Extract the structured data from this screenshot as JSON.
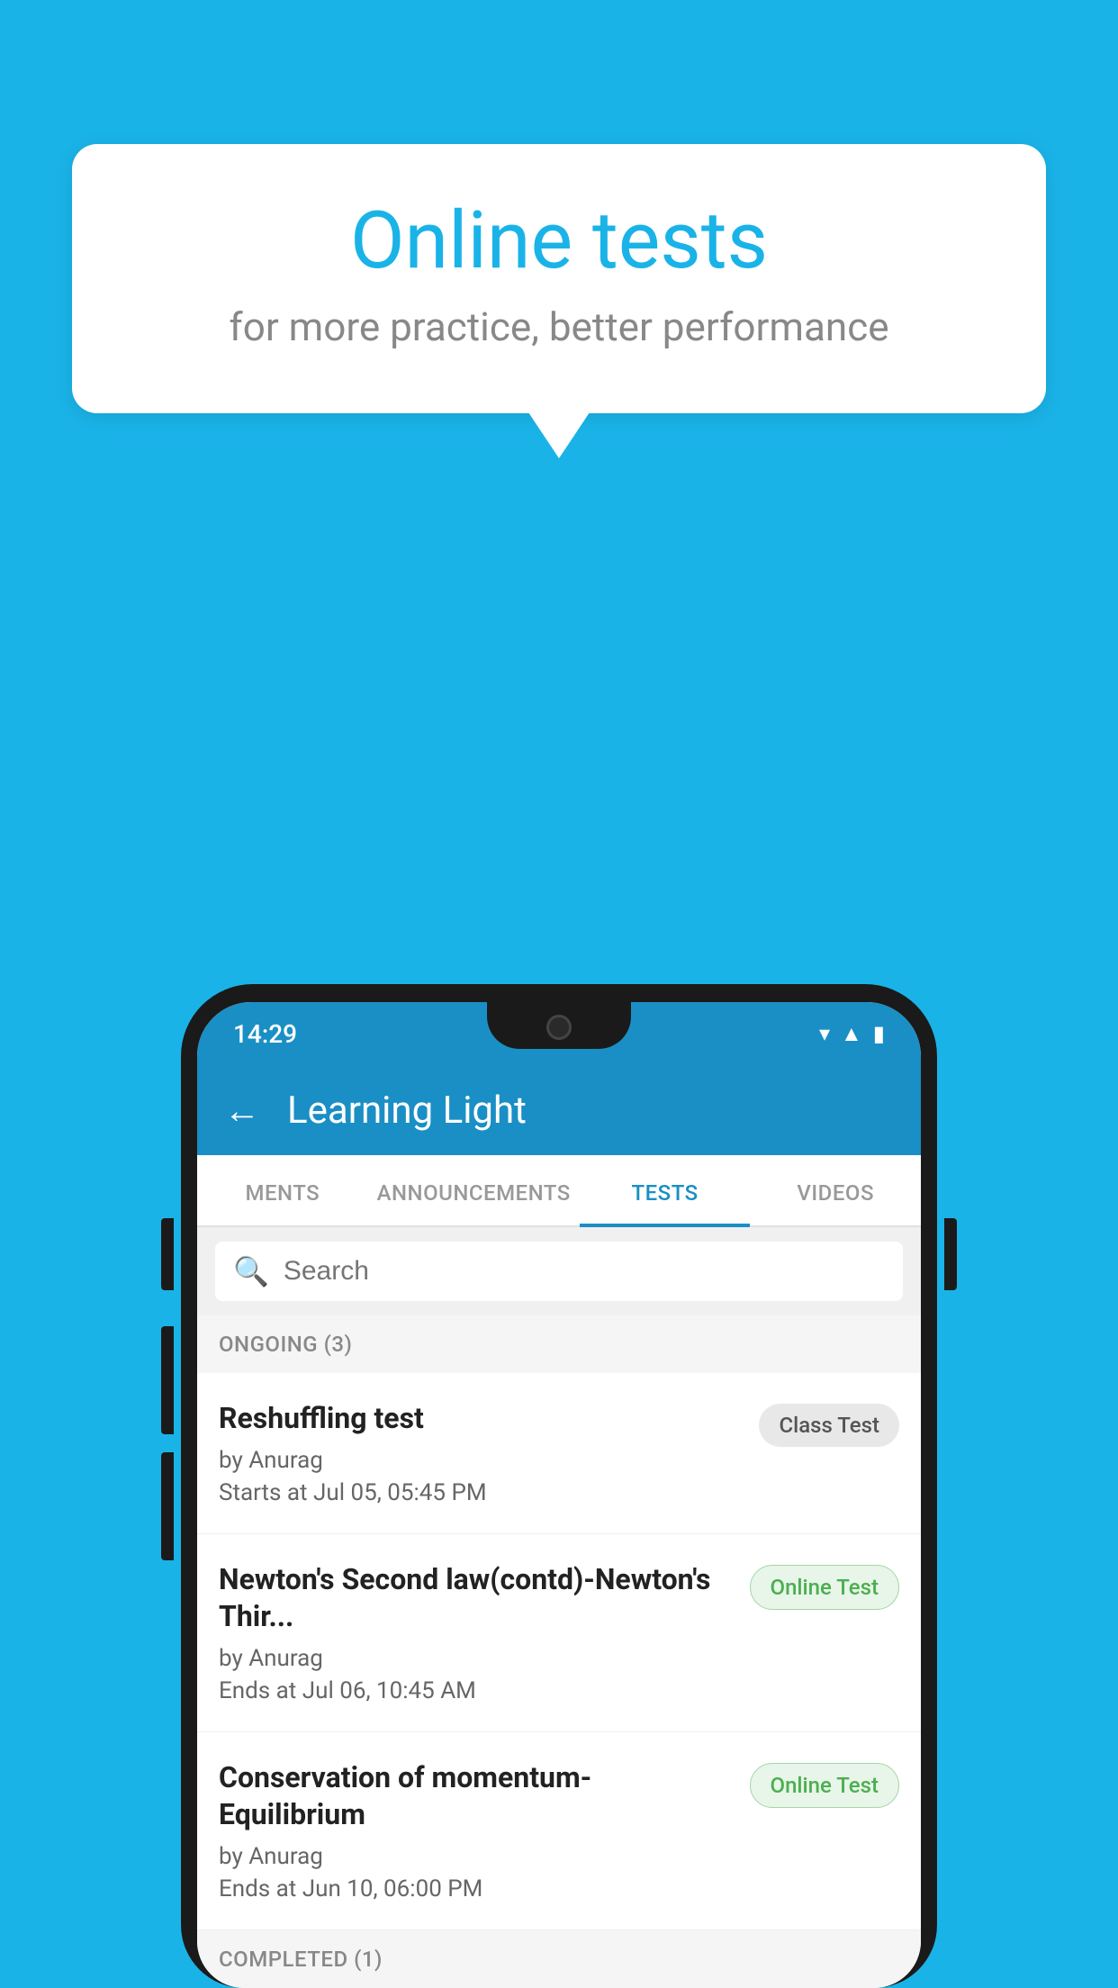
{
  "background_color": "#1ab3e8",
  "bubble": {
    "title": "Online tests",
    "subtitle": "for more practice, better performance"
  },
  "phone": {
    "status_bar": {
      "time": "14:29",
      "icons": [
        "wifi",
        "signal",
        "battery"
      ]
    },
    "header": {
      "app_name": "Learning Light",
      "back_label": "←"
    },
    "tabs": [
      {
        "label": "MENTS",
        "active": false
      },
      {
        "label": "ANNOUNCEMENTS",
        "active": false
      },
      {
        "label": "TESTS",
        "active": true
      },
      {
        "label": "VIDEOS",
        "active": false
      }
    ],
    "search": {
      "placeholder": "Search"
    },
    "ongoing_section": {
      "label": "ONGOING (3)"
    },
    "tests": [
      {
        "name": "Reshuffling test",
        "by": "by Anurag",
        "time_label": "Starts at",
        "time_value": "Jul 05, 05:45 PM",
        "badge": "Class Test",
        "badge_type": "class"
      },
      {
        "name": "Newton's Second law(contd)-Newton's Thir...",
        "by": "by Anurag",
        "time_label": "Ends at",
        "time_value": "Jul 06, 10:45 AM",
        "badge": "Online Test",
        "badge_type": "online"
      },
      {
        "name": "Conservation of momentum-Equilibrium",
        "by": "by Anurag",
        "time_label": "Ends at",
        "time_value": "Jun 10, 06:00 PM",
        "badge": "Online Test",
        "badge_type": "online"
      }
    ],
    "completed_section": {
      "label": "COMPLETED (1)"
    }
  }
}
